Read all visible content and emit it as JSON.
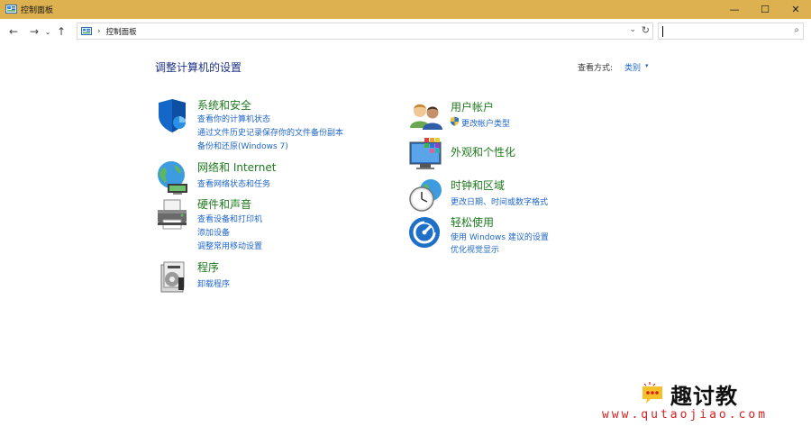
{
  "window": {
    "title": "控制面板",
    "controls": {
      "minimize": "—",
      "maximize": "☐",
      "close": "✕"
    }
  },
  "nav": {
    "back": "←",
    "forward": "→",
    "recent": "⌄",
    "up": "↑",
    "separator": "›",
    "breadcrumb": "控制面板",
    "dropdown": "⌄",
    "refresh": "↻",
    "search_placeholder": "",
    "search_icon": "⌕"
  },
  "main": {
    "title": "调整计算机的设置",
    "view_by_label": "查看方式:",
    "view_by_value": "类别",
    "view_by_arrow": "▾"
  },
  "categories": [
    {
      "icon": "shield-icon",
      "title": "系统和安全",
      "links": [
        "查看你的计算机状态",
        "通过文件历史记录保存你的文件备份副本",
        "备份和还原(Windows 7)"
      ]
    },
    {
      "icon": "network-globe-icon",
      "title": "网络和 Internet",
      "links": [
        "查看网络状态和任务"
      ]
    },
    {
      "icon": "printer-icon",
      "title": "硬件和声音",
      "links": [
        "查看设备和打印机",
        "添加设备",
        "调整常用移动设置"
      ]
    },
    {
      "icon": "programs-icon",
      "title": "程序",
      "links": [
        "卸载程序"
      ]
    },
    {
      "icon": "users-icon",
      "title": "用户帐户",
      "links": [
        "更改帐户类型"
      ]
    },
    {
      "icon": "display-color-icon",
      "title": "外观和个性化",
      "links": []
    },
    {
      "icon": "clock-globe-icon",
      "title": "时钟和区域",
      "links": [
        "更改日期、时间或数字格式"
      ]
    },
    {
      "icon": "ease-of-access-icon",
      "title": "轻松使用",
      "links": [
        "使用 Windows 建议的设置",
        "优化视觉显示"
      ]
    }
  ],
  "watermark": {
    "brand": "趣讨教",
    "url": "www.qutaojiao.com"
  }
}
